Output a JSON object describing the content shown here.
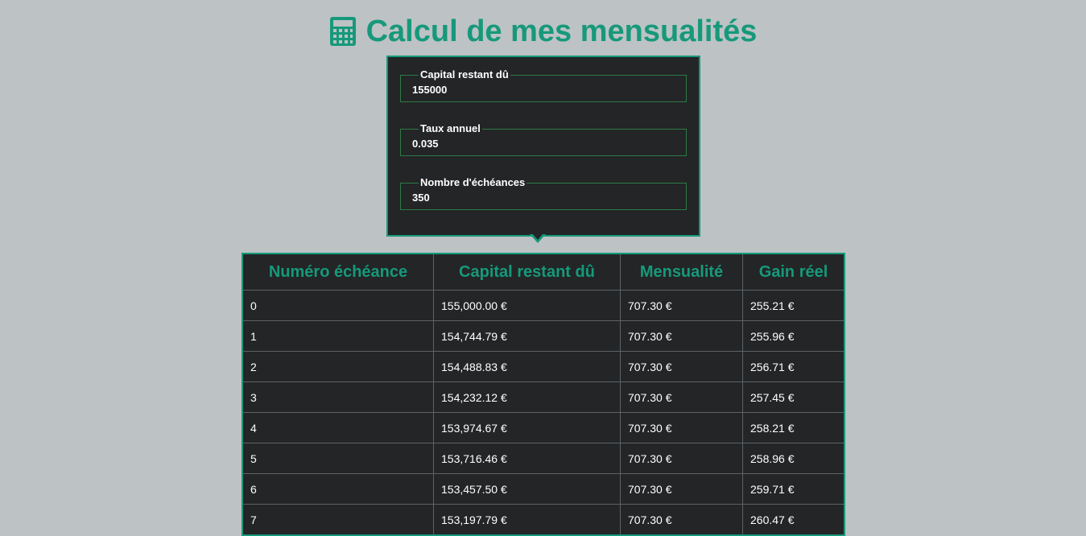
{
  "header": {
    "title": "Calcul de mes mensualités",
    "icon": "calculator-icon",
    "accent_color": "#16997a"
  },
  "form": {
    "capital": {
      "label": "Capital restant dû",
      "value": "155000"
    },
    "rate": {
      "label": "Taux annuel",
      "value": "0.035"
    },
    "count": {
      "label": "Nombre d'échéances",
      "value": "350"
    }
  },
  "table": {
    "headers": [
      "Numéro échéance",
      "Capital restant dû",
      "Mensualité",
      "Gain réel"
    ],
    "rows": [
      [
        "0",
        "155,000.00 €",
        "707.30 €",
        "255.21 €"
      ],
      [
        "1",
        "154,744.79 €",
        "707.30 €",
        "255.96 €"
      ],
      [
        "2",
        "154,488.83 €",
        "707.30 €",
        "256.71 €"
      ],
      [
        "3",
        "154,232.12 €",
        "707.30 €",
        "257.45 €"
      ],
      [
        "4",
        "153,974.67 €",
        "707.30 €",
        "258.21 €"
      ],
      [
        "5",
        "153,716.46 €",
        "707.30 €",
        "258.96 €"
      ],
      [
        "6",
        "153,457.50 €",
        "707.30 €",
        "259.71 €"
      ],
      [
        "7",
        "153,197.79 €",
        "707.30 €",
        "260.47 €"
      ]
    ]
  }
}
